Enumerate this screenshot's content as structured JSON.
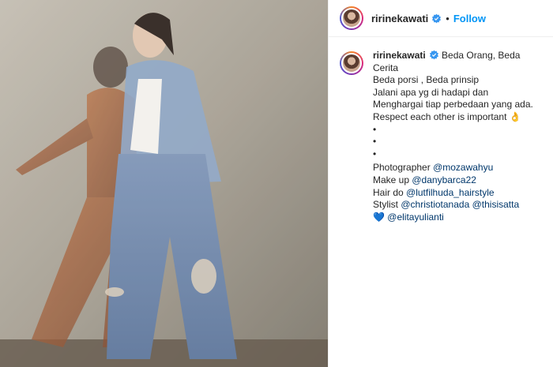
{
  "post": {
    "username": "ririnekawati",
    "follow_label": "Follow",
    "dot": "•"
  },
  "caption": {
    "username": "ririnekawati",
    "first_line": "Beda Orang, Beda",
    "lines": [
      "Cerita",
      "Beda porsi , Beda prinsip",
      "Jalani apa yg di hadapi dan",
      "Menghargai tiap perbedaan yang ada.",
      "Respect each other is important 👌",
      "•",
      "•",
      "•"
    ],
    "credits": [
      {
        "label": "Photographer ",
        "mentions": [
          "@mozawahyu"
        ]
      },
      {
        "label": "Make up ",
        "mentions": [
          "@danybarca22"
        ]
      },
      {
        "label": "Hair do ",
        "mentions": [
          "@lutfilhuda_hairstyle"
        ]
      },
      {
        "label": "Stylist ",
        "mentions": [
          "@christiotanada",
          "@thisisatta"
        ]
      },
      {
        "label": "💙 ",
        "mentions": [
          "@elitayulianti"
        ]
      }
    ]
  },
  "colors": {
    "link_blue": "#0095f6",
    "mention": "#00376b",
    "text": "#262626",
    "verified": "#3897f0"
  },
  "icons": {
    "verified": "verified-badge-icon"
  }
}
